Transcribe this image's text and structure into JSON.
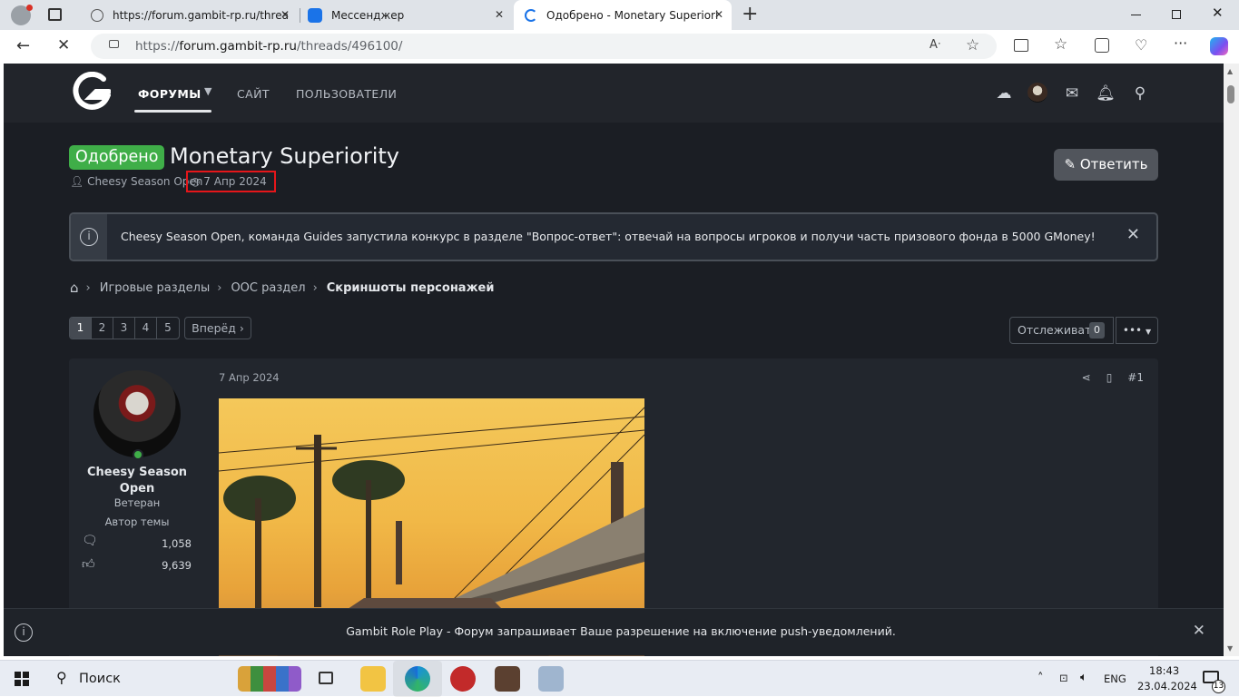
{
  "browser": {
    "tabs": [
      {
        "title": "https://forum.gambit-rp.ru/threa"
      },
      {
        "title": "Мессенджер"
      },
      {
        "title": "Одобрено - Monetary Superiorit"
      }
    ],
    "new_tab": "+",
    "url_prefix": "https://",
    "url_host": "forum.gambit-rp.ru",
    "url_path": "/threads/496100/"
  },
  "nav": {
    "forums": "ФОРУМЫ",
    "site": "САЙТ",
    "users": "ПОЛЬЗОВАТЕЛИ"
  },
  "thread": {
    "badge": "Одобрено",
    "title": "Monetary Superiority",
    "author": "Cheesy Season Open",
    "date": "7 Апр 2024",
    "reply_label": "Ответить"
  },
  "notice": {
    "text": "Cheesy Season Open, команда Guides запустила конкурс в разделе \"Вопрос-ответ\": отвечай на вопросы игроков и получи часть призового фонда в 5000 GMoney!"
  },
  "breadcrumb": [
    "Игровые разделы",
    "OOC раздел",
    "Скриншоты персонажей"
  ],
  "pagination": {
    "pages": [
      "1",
      "2",
      "3",
      "4",
      "5"
    ],
    "current": "1",
    "next": "Вперёд ›"
  },
  "watch": {
    "label": "Отслеживать",
    "count": "0",
    "more": "•••"
  },
  "post": {
    "date": "7 Апр 2024",
    "number": "#1",
    "username": "Cheesy Season Open",
    "rank": "Ветеран",
    "role": "Автор темы",
    "messages": "1,058",
    "reactions": "9,639"
  },
  "push": {
    "text": "Gambit Role Play - Форум запрашивает Ваше разрешение на включение push-уведомлений."
  },
  "taskbar": {
    "search": "Поиск",
    "lang": "ENG",
    "time": "18:43",
    "date": "23.04.2024",
    "notifications": "13"
  },
  "colors": {
    "approved": "#3fae48",
    "page_bg": "#1b1e24",
    "highlight": "#e5161a"
  }
}
